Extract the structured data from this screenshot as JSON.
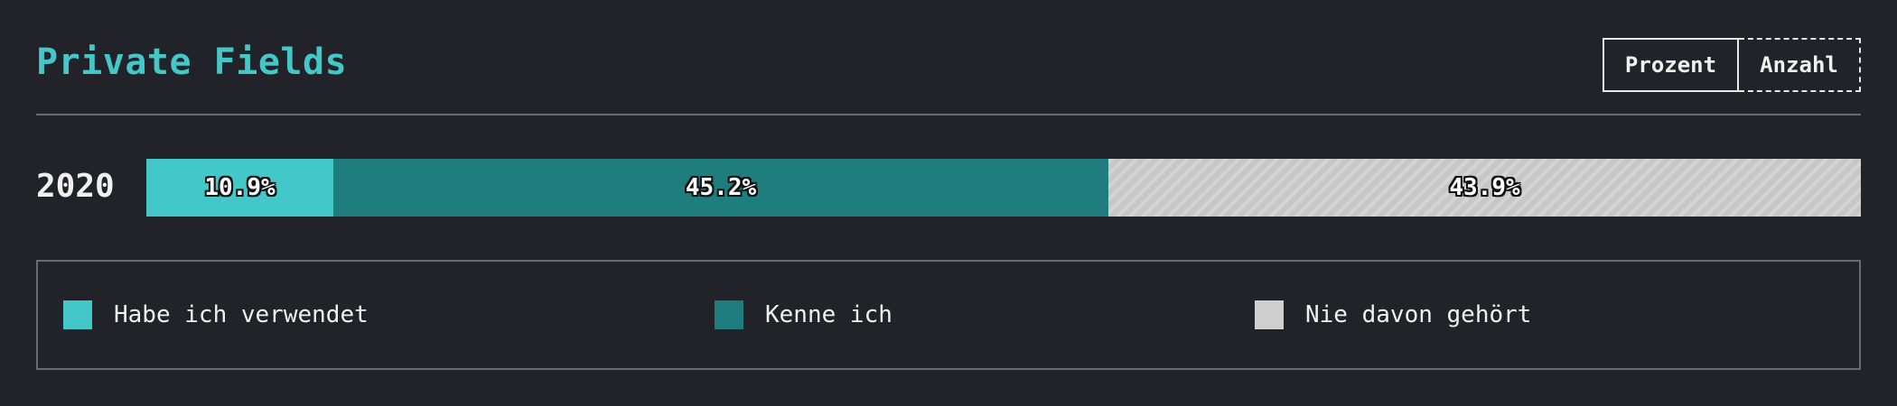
{
  "title": "Private Fields",
  "toggle": {
    "percent_label": "Prozent",
    "count_label": "Anzahl"
  },
  "colors": {
    "background": "#222328",
    "accent": "#44c7c8",
    "used": "#44c7c8",
    "known": "#1f7d7e",
    "never": "#cfcfcf"
  },
  "chart_data": {
    "type": "bar",
    "orientation": "horizontal",
    "stacked": true,
    "normalized": true,
    "title": "Private Fields",
    "categories": [
      "2020"
    ],
    "series": [
      {
        "name": "Habe ich verwendet",
        "values": [
          10.9
        ],
        "label": "10.9%",
        "color": "#44c7c8",
        "pattern": "solid"
      },
      {
        "name": "Kenne ich",
        "values": [
          45.2
        ],
        "label": "45.2%",
        "color": "#1f7d7e",
        "pattern": "solid"
      },
      {
        "name": "Nie davon gehört",
        "values": [
          43.9
        ],
        "label": "43.9%",
        "color": "#cfcfcf",
        "pattern": "hatched"
      }
    ],
    "xlim": [
      0,
      100
    ],
    "grid": false,
    "legend_position": "bottom"
  }
}
